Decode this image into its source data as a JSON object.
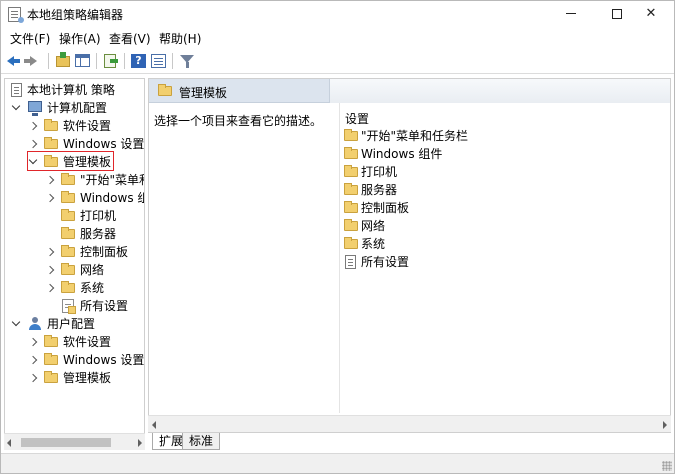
{
  "window": {
    "title": "本地组策略编辑器",
    "controls": {
      "minimize": "",
      "maximize": "",
      "close": "✕"
    }
  },
  "menu": [
    "文件(F)",
    "操作(A)",
    "查看(V)",
    "帮助(H)"
  ],
  "toolbar": {
    "icons": [
      "back-arrow-icon",
      "forward-arrow-icon",
      "folder-up-icon",
      "show-hide-tree-icon",
      "export-list-icon",
      "help-icon",
      "properties-icon",
      "filter-icon"
    ]
  },
  "tree": {
    "root": "本地计算机 策略",
    "computer_config": {
      "label": "计算机配置",
      "children": {
        "software": "软件设置",
        "windows": "Windows 设置",
        "admin_templates": {
          "label": "管理模板",
          "children": [
            "\"开始\"菜单和",
            "Windows 组件",
            "打印机",
            "服务器",
            "控制面板",
            "网络",
            "系统"
          ],
          "all_settings": "所有设置"
        }
      }
    },
    "user_config": {
      "label": "用户配置",
      "children": [
        "软件设置",
        "Windows 设置",
        "管理模板"
      ]
    }
  },
  "right_pane": {
    "header": "管理模板",
    "description": "选择一个项目来查看它的描述。",
    "column_header": "设置",
    "items": [
      "\"开始\"菜单和任务栏",
      "Windows 组件",
      "打印机",
      "服务器",
      "控制面板",
      "网络",
      "系统"
    ],
    "all_settings": "所有设置"
  },
  "tabs": [
    "扩展",
    "标准"
  ],
  "colors": {
    "highlight_border": "#e0262a",
    "header_bg": "#dce4ee",
    "folder": "#f2cf6e"
  }
}
